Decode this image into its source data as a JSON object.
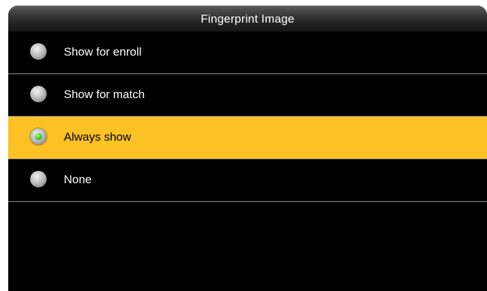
{
  "header": {
    "title": "Fingerprint Image"
  },
  "options": [
    {
      "label": "Show for enroll",
      "selected": false
    },
    {
      "label": "Show for match",
      "selected": false
    },
    {
      "label": "Always show",
      "selected": true
    },
    {
      "label": "None",
      "selected": false
    }
  ],
  "colors": {
    "background": "#000000",
    "selected_background": "#fbc125",
    "radio_selected": "#2fd12a",
    "divider": "#9a9a9a"
  }
}
